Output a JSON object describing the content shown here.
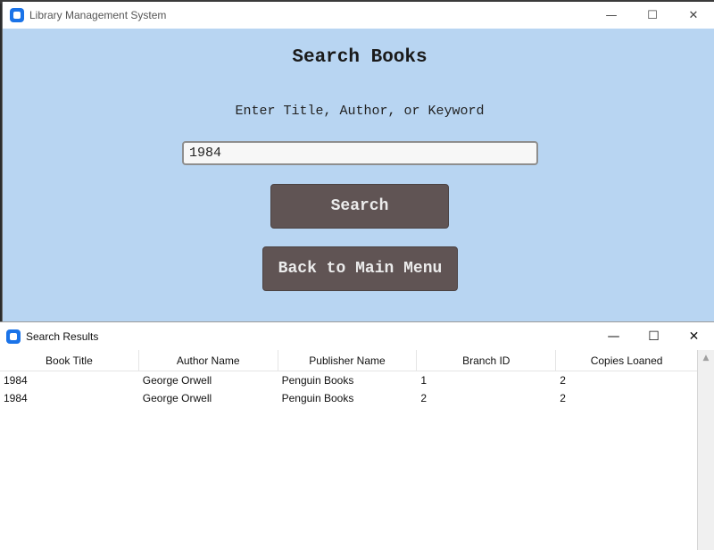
{
  "main_window": {
    "title": "Library Management System",
    "controls": {
      "minimize": "—",
      "maximize": "☐",
      "close": "✕"
    },
    "heading": "Search Books",
    "prompt": "Enter Title, Author, or Keyword",
    "search_value": "1984",
    "search_button": "Search",
    "back_button": "Back to Main Menu"
  },
  "results_window": {
    "title": "Search Results",
    "controls": {
      "minimize": "—",
      "maximize": "☐",
      "close": "✕"
    },
    "columns": [
      "Book Title",
      "Author Name",
      "Publisher Name",
      "Branch ID",
      "Copies Loaned"
    ],
    "rows": [
      [
        "1984",
        "George Orwell",
        "Penguin Books",
        "1",
        "2"
      ],
      [
        "1984",
        "George Orwell",
        "Penguin Books",
        "2",
        "2"
      ]
    ]
  },
  "colors": {
    "main_background": "#b8d5f2",
    "button_background": "#605454",
    "app_icon": "#1a73e8"
  }
}
